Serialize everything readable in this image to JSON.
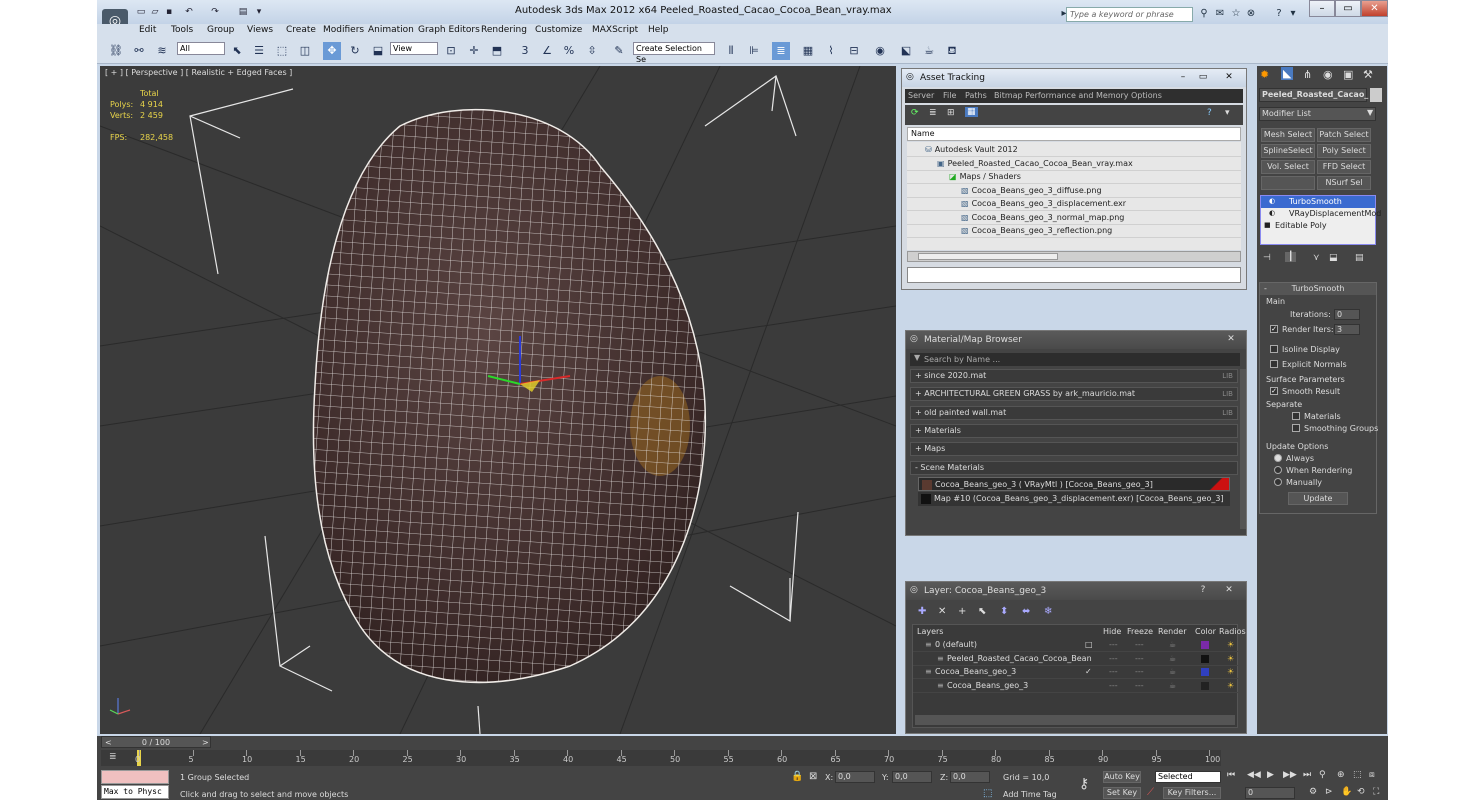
{
  "app": {
    "title": "Autodesk 3ds Max  2012 x64     Peeled_Roasted_Cacao_Cocoa_Bean_vray.max",
    "search_placeholder": "Type a keyword or phrase"
  },
  "menu": [
    "Edit",
    "Tools",
    "Group",
    "Views",
    "Create",
    "Modifiers",
    "Animation",
    "Graph Editors",
    "Rendering",
    "Customize",
    "MAXScript",
    "Help"
  ],
  "toolbar": {
    "selection_filter": "All",
    "ref_coord": "View",
    "named_selection": "Create Selection Se"
  },
  "viewport": {
    "label": "[ + ] [ Perspective ] [ Realistic + Edged Faces ]",
    "stats": {
      "total_label": "Total",
      "polys_label": "Polys:",
      "polys": "4 914",
      "verts_label": "Verts:",
      "verts": "2 459",
      "fps_label": "FPS:",
      "fps": "282,458"
    }
  },
  "asset_tracking": {
    "title": "Asset Tracking",
    "menu": [
      "Server",
      "File",
      "Paths",
      "Bitmap Performance and Memory",
      "Options"
    ],
    "column": "Name",
    "rows": [
      {
        "text": "Autodesk Vault 2012",
        "indent": 0
      },
      {
        "text": "Peeled_Roasted_Cacao_Cocoa_Bean_vray.max",
        "indent": 1
      },
      {
        "text": "Maps / Shaders",
        "indent": 2
      },
      {
        "text": "Cocoa_Beans_geo_3_diffuse.png",
        "indent": 3
      },
      {
        "text": "Cocoa_Beans_geo_3_displacement.exr",
        "indent": 3
      },
      {
        "text": "Cocoa_Beans_geo_3_normal_map.png",
        "indent": 3
      },
      {
        "text": "Cocoa_Beans_geo_3_reflection.png",
        "indent": 3
      }
    ]
  },
  "material_browser": {
    "title": "Material/Map Browser",
    "search_placeholder": "Search by Name ...",
    "groups": [
      {
        "label": "+ since 2020.mat",
        "tag": "LIB"
      },
      {
        "label": "+ ARCHITECTURAL GREEN GRASS by ark_mauricio.mat",
        "tag": "LIB"
      },
      {
        "label": "+ old painted wall.mat",
        "tag": "LIB"
      },
      {
        "label": "+ Materials",
        "tag": ""
      },
      {
        "label": "+ Maps",
        "tag": ""
      },
      {
        "label": "- Scene Materials",
        "tag": ""
      }
    ],
    "scene_items": [
      "Cocoa_Beans_geo_3  ( VRayMtl )  [Cocoa_Beans_geo_3]",
      "Map #10 (Cocoa_Beans_geo_3_displacement.exr) [Cocoa_Beans_geo_3]"
    ]
  },
  "layer_panel": {
    "title": "Layer: Cocoa_Beans_geo_3",
    "columns": [
      "Layers",
      "Hide",
      "Freeze",
      "Render",
      "Color",
      "Radios"
    ],
    "rows": [
      {
        "name": "0 (default)",
        "indent": 0,
        "color": "#7a2aa8",
        "check": "□"
      },
      {
        "name": "Peeled_Roasted_Cacao_Cocoa_Bean",
        "indent": 1,
        "color": "#111111",
        "check": ""
      },
      {
        "name": "Cocoa_Beans_geo_3",
        "indent": 0,
        "color": "#3040c0",
        "check": "✓"
      },
      {
        "name": "Cocoa_Beans_geo_3",
        "indent": 1,
        "color": "#222222",
        "check": ""
      }
    ]
  },
  "command_panel": {
    "object_name": "Peeled_Roasted_Cacao_",
    "modifier_list": "Modifier List",
    "buttons": [
      [
        "Mesh Select",
        "Patch Select"
      ],
      [
        "SplineSelect",
        "Poly Select"
      ],
      [
        "Vol. Select",
        "FFD Select"
      ],
      [
        "",
        "NSurf Sel"
      ]
    ],
    "stack": [
      "TurboSmooth",
      "VRayDisplacementMod",
      "Editable Poly"
    ],
    "rollout_title": "TurboSmooth",
    "main_label": "Main",
    "iterations_label": "Iterations:",
    "iterations": "0",
    "render_iters_label": "Render Iters:",
    "render_iters": "3",
    "isoline": "Isoline Display",
    "explicit": "Explicit Normals",
    "surface_params": "Surface Parameters",
    "smooth_result": "Smooth Result",
    "separate": "Separate",
    "materials": "Materials",
    "smoothing_groups": "Smoothing Groups",
    "update_options": "Update Options",
    "always": "Always",
    "when_rendering": "When Rendering",
    "manually": "Manually",
    "update_btn": "Update"
  },
  "timeline": {
    "frame": "0 / 100",
    "ticks": [
      "0",
      "5",
      "10",
      "15",
      "20",
      "25",
      "30",
      "35",
      "40",
      "45",
      "50",
      "55",
      "60",
      "65",
      "70",
      "75",
      "80",
      "85",
      "90",
      "95",
      "100"
    ]
  },
  "status": {
    "selected": "1 Group Selected",
    "prompt": "Click and drag to select and move objects",
    "maxscript": "Max to Physc",
    "x_label": "X:",
    "x": "0,0",
    "y_label": "Y:",
    "y": "0,0",
    "z_label": "Z:",
    "z": "0,0",
    "grid": "Grid = 10,0",
    "auto_key": "Auto Key",
    "set_key": "Set Key",
    "key_mode": "Selected",
    "key_filters": "Key Filters...",
    "add_time_tag": "Add Time Tag",
    "frame_field": "0"
  }
}
